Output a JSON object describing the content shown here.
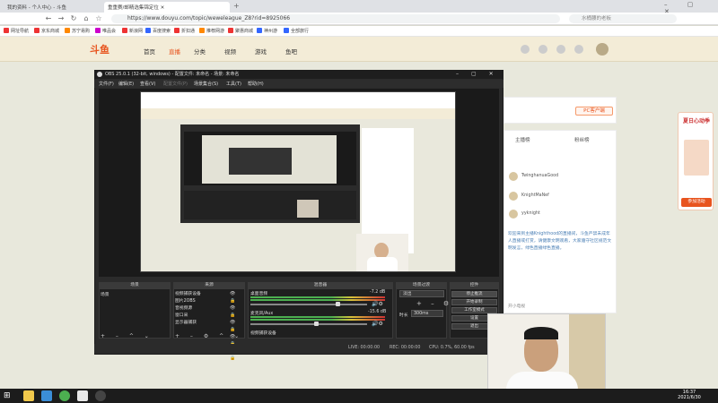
{
  "browser": {
    "tabs": [
      {
        "label": "我的资料 - 个人中心 - 斗鱼"
      },
      {
        "label": "重重赛/邮精选集锦定位"
      }
    ],
    "url": "https://www.douyu.com/topic/weweleague_Z8?rid=8925066",
    "search_placeholder": "水桶腰的老板",
    "bookmarks": [
      {
        "label": "网址导航",
        "color": "#e33"
      },
      {
        "label": "京东商城",
        "color": "#e33"
      },
      {
        "label": "苏宁易购",
        "color": "#f80"
      },
      {
        "label": "唯品会",
        "color": "#c0c"
      },
      {
        "label": "新浪网",
        "color": "#e33"
      },
      {
        "label": "百度搜索",
        "color": "#36f"
      },
      {
        "label": "折扣通",
        "color": "#e33"
      },
      {
        "label": "推荐网游",
        "color": "#f80"
      },
      {
        "label": "聚惠商城",
        "color": "#e33"
      },
      {
        "label": "神州游",
        "color": "#36f"
      },
      {
        "label": "全部旅行",
        "color": "#36f"
      }
    ]
  },
  "douyu": {
    "logo": "斗鱼",
    "nav": [
      "首页",
      "直播",
      "分类",
      "视频",
      "游戏",
      "鱼吧"
    ],
    "right_panel": {
      "pc_button": "PC客户端",
      "btn_ranking": "主播榜",
      "btn_fans": "粉丝榜",
      "users": [
        "TwinghanuaGood",
        "KnightMaNef",
        "yyknight"
      ],
      "chat": "欢迎来到主播Knighthood的直播间，斗鱼严禁未成年人直播或打赏，请健康文明观看，大家遵守社区规范文明发言，绿色直播绿色直播。",
      "room_label": "开小电视"
    },
    "promo": "夏日心动季",
    "promo_btn": "参加活动"
  },
  "obs": {
    "title": "OBS 25.0.1 (32-bit, windows) - 配置文件: 未命名 - 场景: 未命名",
    "menu": [
      "文件(F)",
      "编辑(E)",
      "查看(V)",
      "配置文件(P)",
      "场景集合(S)",
      "工具(T)",
      "帮助(H)"
    ],
    "docks": {
      "scenes": {
        "title": "场景",
        "items": [
          "场景"
        ]
      },
      "sources": {
        "title": "来源",
        "items": [
          "视频捕获设备",
          "图片2OBS",
          "音视频源",
          "窗口采",
          "显示器捕获"
        ]
      },
      "mixer": {
        "title": "混音器",
        "ch1": {
          "name": "桌面音频",
          "db": "-7.2 dB"
        },
        "ch2": {
          "name": "麦克风/Aux",
          "db": "-15.6 dB"
        },
        "ch3": {
          "name": "视频捕获设备"
        }
      },
      "transitions": {
        "title": "场景过渡",
        "fade": "淡出",
        "duration_label": "时长",
        "duration": "300ms"
      },
      "controls": {
        "title": "控件",
        "buttons": [
          "停止推流",
          "开始录制",
          "工作室模式",
          "设置",
          "退出"
        ]
      }
    },
    "status": {
      "live": "LIVE: 00:00:00",
      "rec": "REC: 00:00:00",
      "cpu": "CPU: 0.7%, 60.00 fps"
    }
  },
  "taskbar": {
    "time": "16:37",
    "date": "2021/6/30"
  }
}
